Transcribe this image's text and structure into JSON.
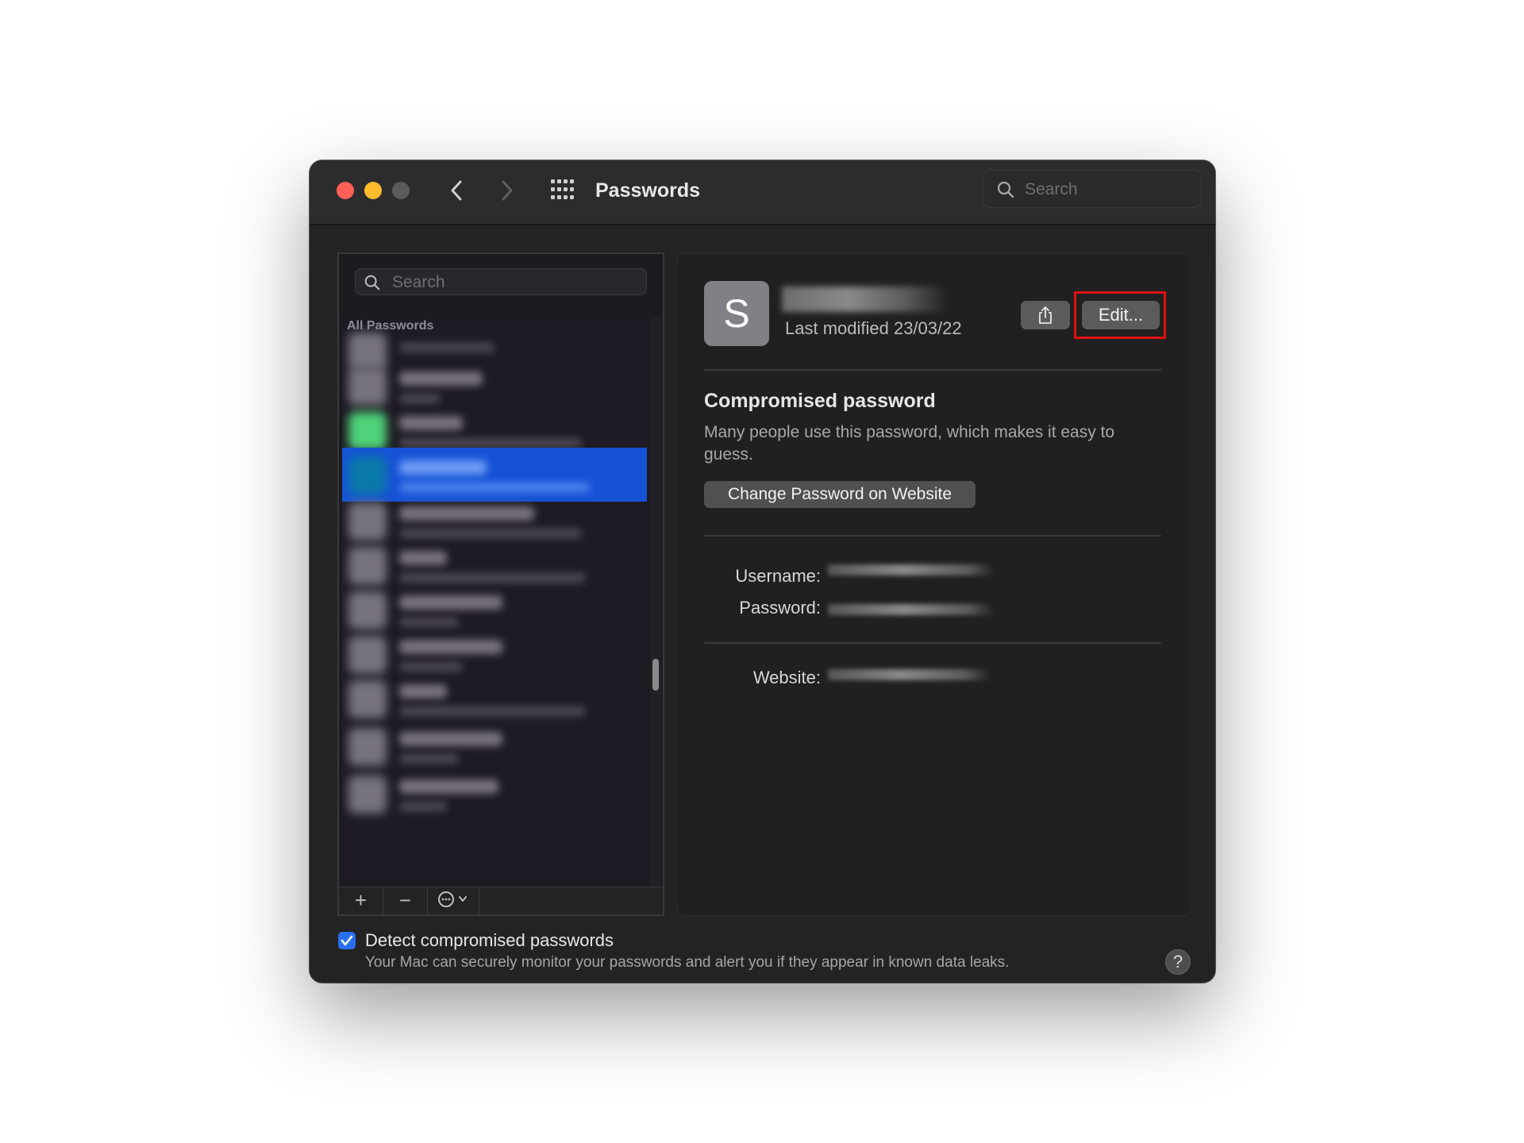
{
  "window": {
    "title": "Passwords",
    "search_placeholder": "Search"
  },
  "sidebar": {
    "search_placeholder": "Search",
    "list_header": "All Passwords",
    "toolbar": {
      "add_label": "+",
      "remove_label": "−",
      "more_icon": "ellipsis-circle-icon"
    }
  },
  "detail": {
    "avatar_letter": "S",
    "last_modified": "Last modified 23/03/22",
    "share_icon": "share-icon",
    "edit_label": "Edit...",
    "compromised_title": "Compromised password",
    "compromised_description": "Many people use this password, which makes it easy to guess.",
    "change_password_label": "Change Password on Website",
    "username_label": "Username:",
    "password_label": "Password:",
    "website_label": "Website:"
  },
  "footer": {
    "detect_label": "Detect compromised passwords",
    "detect_checked": true,
    "detect_description": "Your Mac can securely monitor your passwords and alert you if they appear in known data leaks.",
    "help_label": "?"
  },
  "colors": {
    "accent": "#1652d6",
    "highlight_box": "#e01010",
    "close": "#fe5f57",
    "minimize": "#febc2e"
  }
}
